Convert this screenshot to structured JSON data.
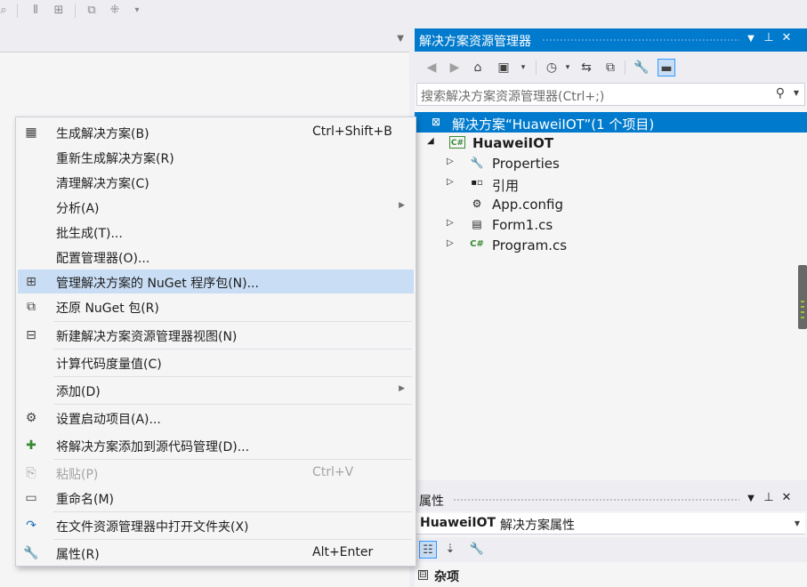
{
  "toolbar": {
    "icons": [
      "zoom-icon",
      "align-icon",
      "layout-icon",
      "window-icon",
      "shuffle-icon",
      "overflow-icon"
    ]
  },
  "context_menu": {
    "items": [
      {
        "label": "生成解决方案(B)",
        "shortcut": "Ctrl+Shift+B",
        "icon": "build-icon",
        "glyph": "▦"
      },
      {
        "label": "重新生成解决方案(R)",
        "shortcut": "",
        "icon": "",
        "glyph": ""
      },
      {
        "label": "清理解决方案(C)",
        "shortcut": "",
        "icon": "",
        "glyph": ""
      },
      {
        "label": "分析(A)",
        "shortcut": "",
        "icon": "",
        "glyph": "",
        "submenu": true
      },
      {
        "label": "批生成(T)...",
        "shortcut": "",
        "icon": "",
        "glyph": ""
      },
      {
        "label": "配置管理器(O)...",
        "shortcut": "",
        "icon": "",
        "glyph": ""
      },
      {
        "label": "管理解决方案的 NuGet 程序包(N)...",
        "shortcut": "",
        "icon": "nuget-icon",
        "glyph": "⊞",
        "highlighted": true
      },
      {
        "label": "还原 NuGet 包(R)",
        "shortcut": "",
        "icon": "restore-icon",
        "glyph": "⧉"
      },
      {
        "label": "新建解决方案资源管理器视图(N)",
        "shortcut": "",
        "icon": "new-view-icon",
        "glyph": "⊟"
      },
      {
        "label": "计算代码度量值(C)",
        "shortcut": "",
        "icon": "",
        "glyph": ""
      },
      {
        "label": "添加(D)",
        "shortcut": "",
        "icon": "",
        "glyph": "",
        "submenu": true
      },
      {
        "label": "设置启动项目(A)...",
        "shortcut": "",
        "icon": "gear-icon",
        "glyph": "⚙"
      },
      {
        "label": "将解决方案添加到源代码管理(D)...",
        "shortcut": "",
        "icon": "source-control-icon",
        "glyph": "✚"
      },
      {
        "label": "粘贴(P)",
        "shortcut": "Ctrl+V",
        "icon": "paste-icon",
        "glyph": "⎘",
        "disabled": true
      },
      {
        "label": "重命名(M)",
        "shortcut": "",
        "icon": "rename-icon",
        "glyph": "▭"
      },
      {
        "label": "在文件资源管理器中打开文件夹(X)",
        "shortcut": "",
        "icon": "open-folder-icon",
        "glyph": "↷"
      },
      {
        "label": "属性(R)",
        "shortcut": "Alt+Enter",
        "icon": "wrench-icon",
        "glyph": "🔧"
      }
    ]
  },
  "solution_explorer": {
    "title": "解决方案资源管理器",
    "search_placeholder": "搜索解决方案资源管理器(Ctrl+;)",
    "tree": [
      {
        "label": "解决方案“HuaweiIOT”(1 个项目)",
        "icon": "solution-icon",
        "glyph": "⊠",
        "selected": true,
        "level": 0
      },
      {
        "label": "HuaweiIOT",
        "icon": "csharp-project-icon",
        "glyph": "C#",
        "expanded": true,
        "bold": true,
        "level": 0
      },
      {
        "label": "Properties",
        "icon": "wrench-icon",
        "glyph": "🔧",
        "collapsed": true,
        "level": 1
      },
      {
        "label": "引用",
        "icon": "references-icon",
        "glyph": "▪▫",
        "collapsed": true,
        "level": 1
      },
      {
        "label": "App.config",
        "icon": "config-icon",
        "glyph": "⚙",
        "level": 1
      },
      {
        "label": "Form1.cs",
        "icon": "form-icon",
        "glyph": "▤",
        "collapsed": true,
        "level": 1
      },
      {
        "label": "Program.cs",
        "icon": "csharp-file-icon",
        "glyph": "C#",
        "collapsed": true,
        "level": 1
      }
    ]
  },
  "properties": {
    "title": "属性",
    "object_name": "HuaweiIOT",
    "object_desc": "解决方案属性",
    "category": "杂项",
    "category_box": "⊟"
  }
}
